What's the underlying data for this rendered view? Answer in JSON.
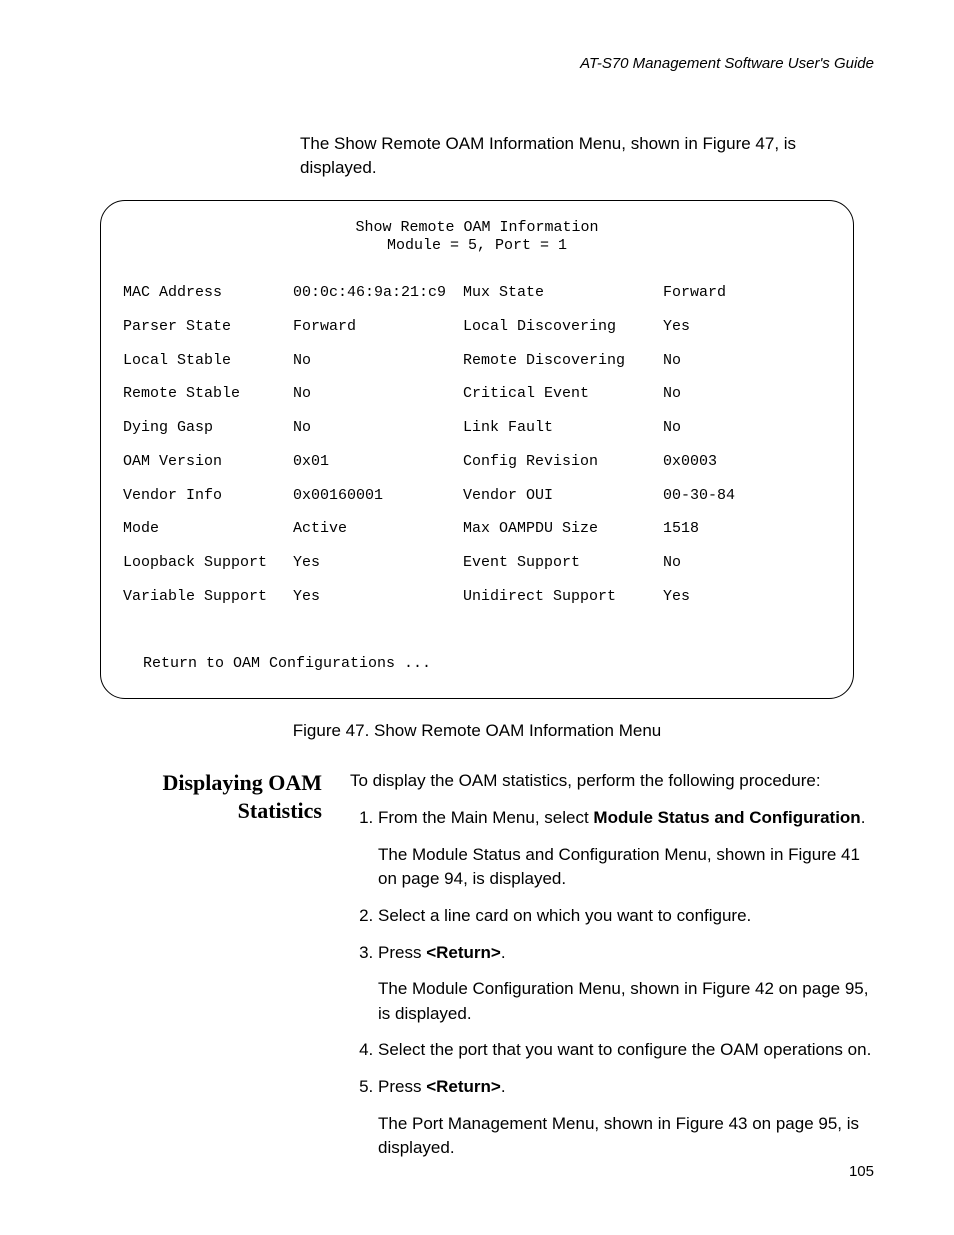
{
  "header": {
    "guide_title": "AT-S70 Management Software User's Guide"
  },
  "intro": {
    "p1a": "The Show Remote OAM Information Menu, shown in Figure 47, is displayed."
  },
  "menu": {
    "title_l1": "Show Remote OAM Information",
    "title_l2": "Module = 5, Port = 1",
    "rows": [
      {
        "l_label": "MAC Address",
        "l_value": "00:0c:46:9a:21:c9",
        "r_label": "Mux State",
        "r_value": "Forward"
      },
      {
        "l_label": "Parser State",
        "l_value": "Forward",
        "r_label": "Local Discovering",
        "r_value": "Yes"
      },
      {
        "l_label": "Local Stable",
        "l_value": "No",
        "r_label": "Remote Discovering",
        "r_value": "No"
      },
      {
        "l_label": "Remote Stable",
        "l_value": "No",
        "r_label": "Critical Event",
        "r_value": "No"
      },
      {
        "l_label": "Dying Gasp",
        "l_value": "No",
        "r_label": "Link Fault",
        "r_value": "No"
      },
      {
        "l_label": "OAM Version",
        "l_value": "0x01",
        "r_label": "Config Revision",
        "r_value": "0x0003"
      },
      {
        "l_label": "Vendor Info",
        "l_value": "0x00160001",
        "r_label": "Vendor OUI",
        "r_value": "00-30-84"
      },
      {
        "l_label": "Mode",
        "l_value": "Active",
        "r_label": "Max OAMPDU Size",
        "r_value": "1518"
      },
      {
        "l_label": "Loopback Support",
        "l_value": "Yes",
        "r_label": "Event Support",
        "r_value": "No"
      },
      {
        "l_label": "Variable Support",
        "l_value": "Yes",
        "r_label": "Unidirect Support",
        "r_value": "Yes"
      }
    ],
    "return_line": "Return to OAM Configurations ..."
  },
  "caption": "Figure 47. Show Remote OAM Information Menu",
  "section": {
    "heading_l1": "Displaying OAM",
    "heading_l2": "Statistics",
    "intro_line": "To display the OAM statistics, perform the following procedure:",
    "steps": {
      "s1": {
        "pre": "From the Main Menu, select ",
        "bold": "Module Status and Configuration",
        "post": ".",
        "note": "The Module Status and Configuration Menu, shown in Figure 41 on page 94, is displayed."
      },
      "s2": {
        "text": "Select a line card on which you want to configure."
      },
      "s3": {
        "pre": "Press ",
        "bold": "<Return>",
        "post": ".",
        "note": "The Module Configuration Menu, shown in Figure 42 on page 95, is displayed."
      },
      "s4": {
        "text": "Select the port that you want to configure the OAM operations on."
      },
      "s5": {
        "pre": "Press ",
        "bold": "<Return>",
        "post": ".",
        "note": "The Port Management Menu, shown in Figure 43 on page 95, is displayed."
      }
    }
  },
  "page_number": "105"
}
